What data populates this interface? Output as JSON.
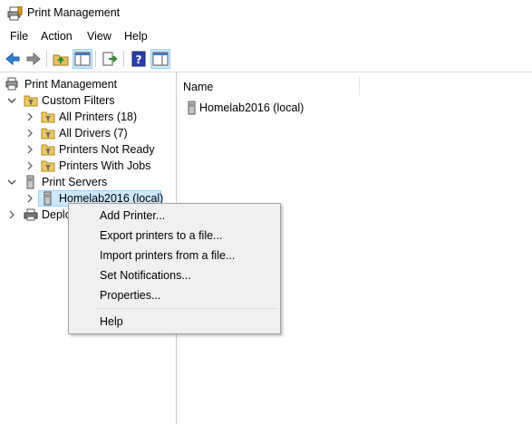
{
  "window": {
    "title": "Print Management"
  },
  "menubar": {
    "items": [
      "File",
      "Action",
      "View",
      "Help"
    ]
  },
  "toolbar": {
    "buttons": [
      "back-arrow-icon",
      "forward-arrow-icon",
      "up-folder-icon",
      "show-hide-tree-icon",
      "export-list-icon",
      "help-icon",
      "action-pane-icon"
    ]
  },
  "tree": {
    "root": "Print Management",
    "custom_filters": "Custom Filters",
    "all_printers": "All Printers (18)",
    "all_drivers": "All Drivers (7)",
    "printers_not_ready": "Printers Not Ready",
    "printers_with_jobs": "Printers With Jobs",
    "print_servers": "Print Servers",
    "server": "Homelab2016 (local)",
    "deployed": "Deplo"
  },
  "list": {
    "column_name": "Name",
    "rows": [
      "Homelab2016 (local)"
    ]
  },
  "context_menu": {
    "items": [
      "Add Printer...",
      "Export printers to a file...",
      "Import printers from a file...",
      "Set Notifications...",
      "Properties...",
      "Help"
    ]
  },
  "colors": {
    "selection": "#cce8ff",
    "selection_border": "#99d1ff",
    "menu_bg": "#f0f0f0"
  }
}
